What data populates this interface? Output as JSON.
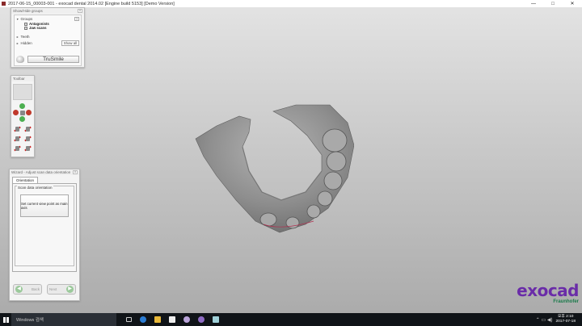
{
  "window": {
    "title": "2017-06-15_00003-001 - exocad dental 2014.02 [Engine build 5153] [Demo Version]",
    "minimize": "—",
    "maximize": "□",
    "close": "✕"
  },
  "showhide": {
    "title": "Show/Hide groups",
    "groups_label": "Groups",
    "help": "?",
    "items": [
      "Antagonists",
      "Jaw scans"
    ],
    "teeth_label": "Teeth",
    "hidden_label": "Hidden",
    "show_all": "Show all",
    "trusmile": "TruSmile"
  },
  "toolbar": {
    "title": "Toolbar"
  },
  "wizard": {
    "title": "Wizard - Adjust scan data orientation",
    "tab": "Orientation",
    "group_label": "Scan data orientation",
    "set_button": "Set current view point as main axis",
    "back": "Back",
    "next": "Next"
  },
  "logo": {
    "brand": "exocad",
    "partner": "Fraunhofer"
  },
  "taskbar": {
    "search": "Windows 검색",
    "tray_symbols": "⌃ ▭ ◀)",
    "time": "오후 2:10",
    "date": "2017-07-18"
  },
  "colors": {
    "accent": "#6a2ca8",
    "scan_surface": "#9a9a9a"
  }
}
